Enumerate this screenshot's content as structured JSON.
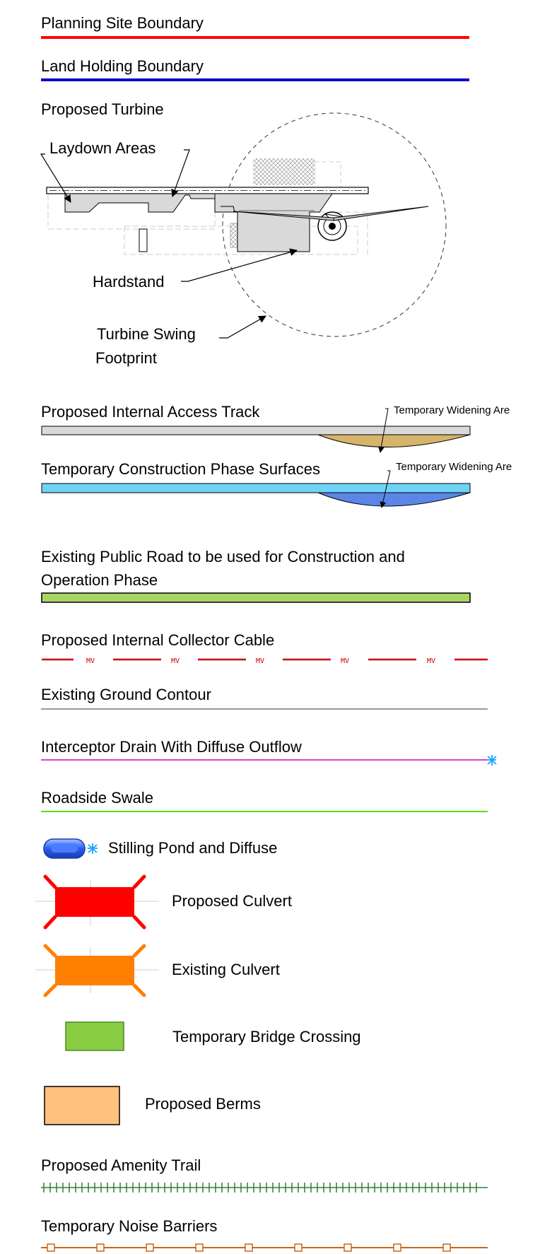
{
  "legend": {
    "planning_site_boundary": {
      "label": "Planning Site Boundary",
      "color": "#ff0000"
    },
    "land_holding_boundary": {
      "label": "Land Holding Boundary",
      "color": "#0000cc"
    },
    "proposed_turbine": {
      "label": "Proposed Turbine",
      "laydown_areas": "Laydown Areas",
      "hardstand": "Hardstand",
      "swing_footprint_line1": "Turbine Swing",
      "swing_footprint_line2": "Footprint"
    },
    "access_track": {
      "label": "Proposed Internal Access Track",
      "widening_label": "Temporary Widening Are",
      "color": "#d9d9d9",
      "widening_color": "#d6b46a"
    },
    "construction_surfaces": {
      "label": "Temporary Construction Phase Surfaces",
      "widening_label": "Temporary Widening Are",
      "color": "#6fd3f5",
      "widening_color": "#5b86e8"
    },
    "public_road": {
      "label_line1": "Existing Public Road to be used for Construction and",
      "label_line2": "Operation Phase",
      "color": "#a9d466"
    },
    "collector_cable": {
      "label": "Proposed Internal Collector Cable",
      "marker": "MV",
      "color": "#cc0000"
    },
    "ground_contour": {
      "label": "Existing Ground Contour",
      "color": "#999999"
    },
    "interceptor_drain": {
      "label": "Interceptor Drain With Diffuse Outflow",
      "color": "#e040d0",
      "outflow_color": "#1aa3ff"
    },
    "roadside_swale": {
      "label": "Roadside Swale",
      "color": "#55dd22"
    },
    "stilling_pond": {
      "label": "Stilling Pond and Diffuse",
      "color": "#2a5cf0"
    },
    "proposed_culvert": {
      "label": "Proposed Culvert",
      "color": "#ff0000"
    },
    "existing_culvert": {
      "label": "Existing Culvert",
      "color": "#ff8000"
    },
    "bridge_crossing": {
      "label": "Temporary Bridge Crossing",
      "color": "#88cc44"
    },
    "proposed_berms": {
      "label": "Proposed Berms",
      "color": "#ffc080"
    },
    "amenity_trail": {
      "label": "Proposed Amenity Trail",
      "color": "#2e7d32"
    },
    "noise_barriers": {
      "label": "Temporary Noise Barriers",
      "color": "#c8661a"
    }
  }
}
